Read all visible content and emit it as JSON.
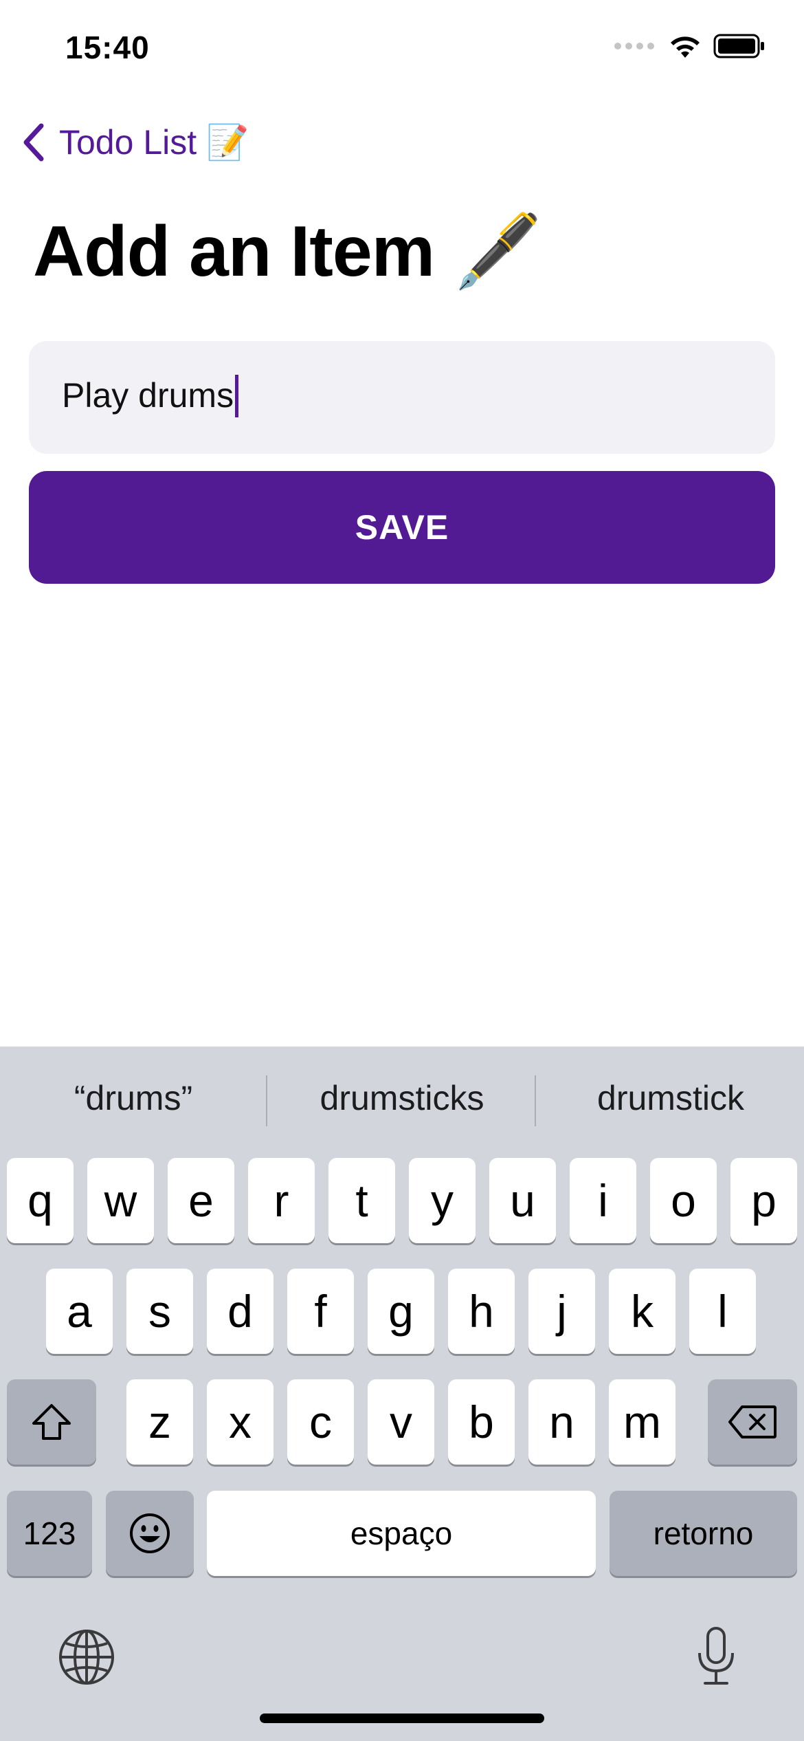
{
  "status_bar": {
    "time": "15:40"
  },
  "nav": {
    "back_label": "Todo List 📝"
  },
  "page": {
    "title": "Add an Item 🖋️"
  },
  "input": {
    "value": "Play drums"
  },
  "save_button": {
    "label": "SAVE"
  },
  "keyboard": {
    "suggestions": [
      "“drums”",
      "drumsticks",
      "drumstick"
    ],
    "row1": [
      "q",
      "w",
      "e",
      "r",
      "t",
      "y",
      "u",
      "i",
      "o",
      "p"
    ],
    "row2": [
      "a",
      "s",
      "d",
      "f",
      "g",
      "h",
      "j",
      "k",
      "l"
    ],
    "row3": [
      "z",
      "x",
      "c",
      "v",
      "b",
      "n",
      "m"
    ],
    "numbers_label": "123",
    "space_label": "espaço",
    "return_label": "retorno"
  },
  "colors": {
    "accent": "#551a99",
    "save_bg": "#521b93",
    "input_bg": "#f1f1f6",
    "keyboard_bg": "#d2d5db"
  }
}
